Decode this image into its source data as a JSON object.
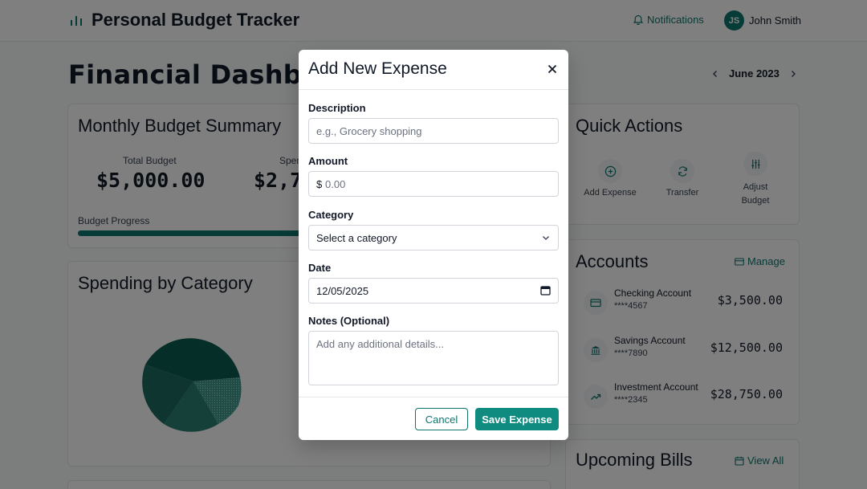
{
  "header": {
    "title": "Personal Budget Tracker",
    "notifications_label": "Notifications",
    "user_initials": "JS",
    "user_name": "John Smith"
  },
  "page_title": "Financial Dashboard",
  "month_nav": {
    "month": "June 2023"
  },
  "budget_summary": {
    "title": "Monthly Budget Summary",
    "total_label": "Total Budget",
    "total_value": "$5,000.00",
    "spent_label": "Spent",
    "spent_value": "$2,7",
    "progress_label": "Budget Progress",
    "progress_fraction": 0.55
  },
  "spending": {
    "title": "Spending by Category"
  },
  "quick_actions": {
    "title": "Quick Actions",
    "items": [
      {
        "label": "Add Expense",
        "icon": "plus-circle-icon"
      },
      {
        "label": "Transfer",
        "icon": "refresh-icon"
      },
      {
        "label": "Adjust Budget",
        "icon": "sliders-icon"
      }
    ]
  },
  "accounts": {
    "title": "Accounts",
    "manage_label": "Manage",
    "items": [
      {
        "name": "Checking Account",
        "number": "****4567",
        "balance": "$3,500.00",
        "icon": "credit-card-icon"
      },
      {
        "name": "Savings Account",
        "number": "****7890",
        "balance": "$12,500.00",
        "icon": "bank-icon"
      },
      {
        "name": "Investment Account",
        "number": "****2345",
        "balance": "$28,750.00",
        "icon": "trending-up-icon"
      }
    ]
  },
  "upcoming_bills": {
    "title": "Upcoming Bills",
    "view_all_label": "View All"
  },
  "modal": {
    "title": "Add New Expense",
    "description_label": "Description",
    "description_placeholder": "e.g., Grocery shopping",
    "amount_label": "Amount",
    "currency_symbol": "$",
    "amount_placeholder": "0.00",
    "category_label": "Category",
    "category_value": "Select a category",
    "date_label": "Date",
    "date_value": "12/05/2025",
    "notes_label": "Notes (Optional)",
    "notes_placeholder": "Add any additional details...",
    "cancel_label": "Cancel",
    "save_label": "Save Expense"
  },
  "colors": {
    "accent": "#0f766e",
    "save_button": "#0f8b80"
  }
}
